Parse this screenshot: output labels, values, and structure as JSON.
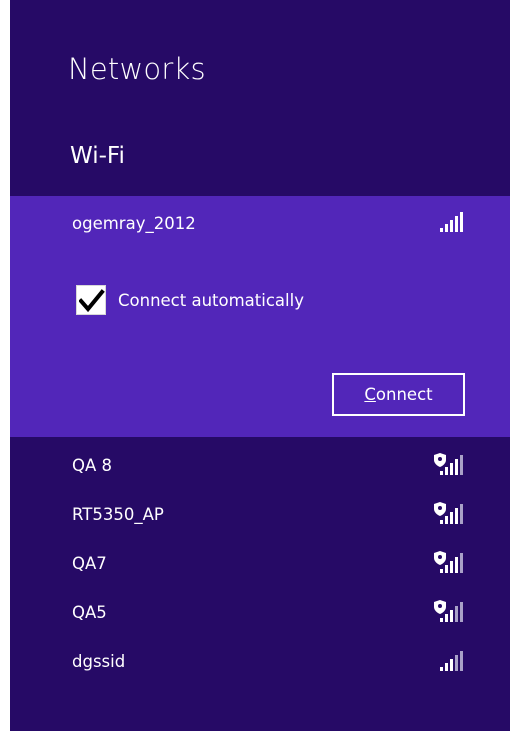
{
  "panel": {
    "title": "Networks",
    "section": "Wi-Fi"
  },
  "selected_network": {
    "name": "ogemray_2012",
    "signal_bars": 5,
    "connect_auto_label": "Connect automatically",
    "connect_auto_checked": true,
    "connect_button": {
      "first": "C",
      "rest": "onnect"
    }
  },
  "networks": [
    {
      "name": "QA 8",
      "secured": true,
      "signal_bars": 4
    },
    {
      "name": "RT5350_AP",
      "secured": true,
      "signal_bars": 4
    },
    {
      "name": "QA7",
      "secured": true,
      "signal_bars": 4
    },
    {
      "name": "QA5",
      "secured": true,
      "signal_bars": 3
    },
    {
      "name": "dgssid",
      "secured": false,
      "signal_bars": 3
    }
  ],
  "colors": {
    "panel_bg": "#260a66",
    "selected_bg": "#5226b9",
    "text": "#ffffff"
  },
  "icons": {
    "signal": "signal-strength-icon",
    "secured": "shield-icon",
    "check": "checkmark-icon"
  }
}
